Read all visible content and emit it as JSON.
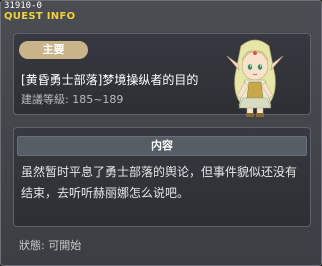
{
  "window": {
    "quest_id": "31910-0",
    "title": "QUEST INFO"
  },
  "quest": {
    "category_badge": "主要",
    "name": "[黄昏勇士部落]梦境操纵者的目的",
    "level_range": "建議等級: 185~189"
  },
  "description": {
    "header": "内容",
    "text": "虽然暂时平息了勇士部落的舆论，但事件貌似还没有结束，去听听赫丽娜怎么说吧。"
  },
  "status": {
    "text": "狀態:  可開始"
  },
  "colors": {
    "title_yellow": "#f2d23a",
    "badge_bg": "#c9b48a",
    "panel_bg": "#2c3035"
  },
  "icons": {
    "portrait": "elf-npc-portrait"
  }
}
